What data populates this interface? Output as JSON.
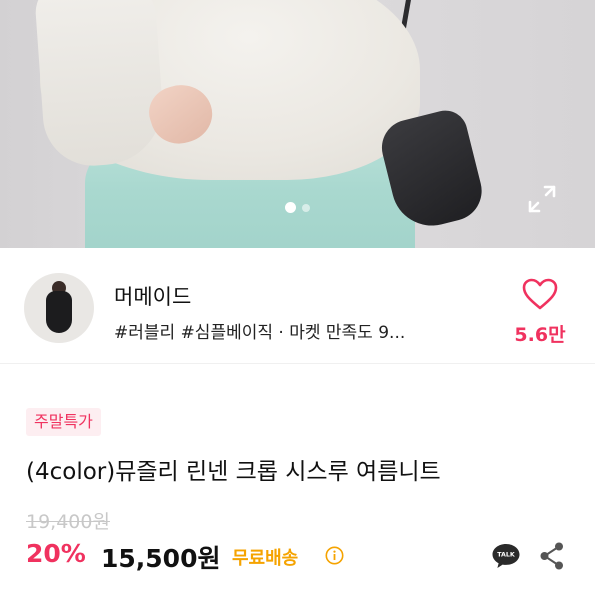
{
  "carousel": {
    "slide_count": 2,
    "active_index": 1
  },
  "seller": {
    "name": "머메이드",
    "tags": "#러블리 #심플베이직 · 마켓 만족도 9...",
    "likes": "5.6만"
  },
  "product": {
    "badge": "주말특가",
    "title": "(4color)뮤즐리 린넨 크롭 시스루 여름니트",
    "original_price": "19,400원",
    "discount": "20%",
    "price": "15,500원",
    "shipping": "무료배송"
  },
  "talk": {
    "label": "TALK"
  },
  "colors": {
    "accent": "#f0325f",
    "shipping": "#f5a300",
    "badge_bg": "#fdeef1"
  },
  "icons": [
    "expand-icon",
    "heart-icon",
    "info-icon",
    "kakao-talk-icon",
    "share-icon"
  ]
}
